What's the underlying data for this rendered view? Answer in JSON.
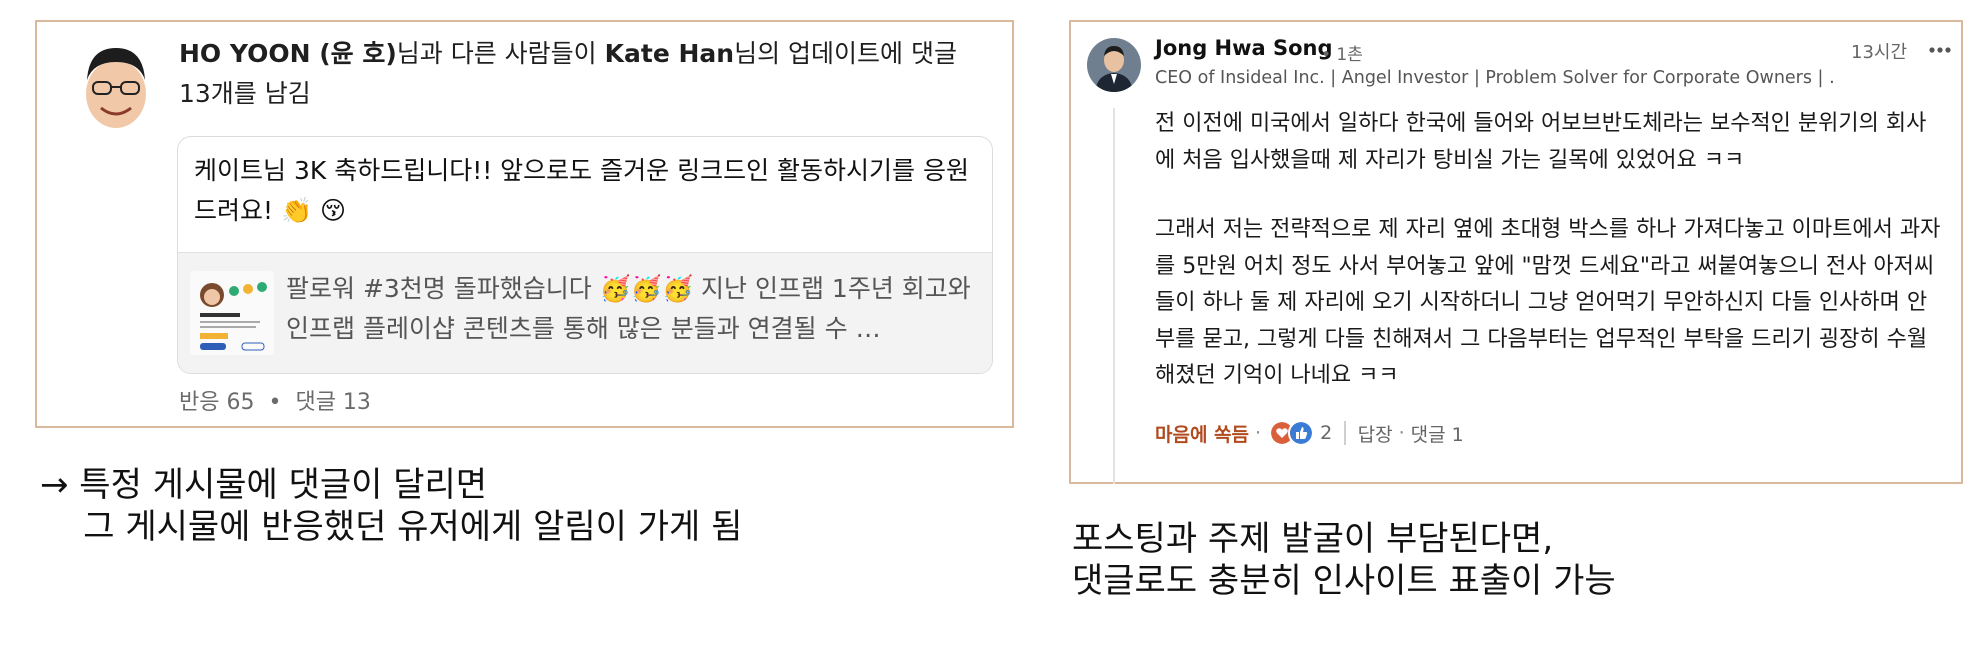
{
  "left_card": {
    "notification": {
      "actor": "HO YOON (윤 호)",
      "text1": "님과 다른 사람들이 ",
      "target": "Kate Han",
      "text2": "님의 업데이트에 댓글 13개를 남김"
    },
    "comment": {
      "text": "케이트님 3K 축하드립니다!! 앞으로도 즐거운 링크드인 활동하시기를 응원드려요! 👏 😚"
    },
    "post_preview": {
      "text": "팔로워 #3천명 돌파했습니다 🥳🥳🥳 지난 인프랩 1주년 회고와 인프랩 플레이샵 콘텐츠를 통해 많은 분들과 연결될 수 …",
      "thumbnail_name": "Kate Han"
    },
    "stats": {
      "reactions": "반응 65",
      "separator": "•",
      "comments": "댓글 13"
    }
  },
  "caption_left": "→ 특정 게시물에 댓글이 달리면\n    그 게시물에 반응했던 유저에게 알림이 가게 됨",
  "right_card": {
    "author": "Jong Hwa Song",
    "degree": "• 1촌",
    "time": "13시간",
    "headline": "CEO of Insideal Inc. | Angel Investor | Problem Solver for Corporate Owners | …",
    "paragraph1": "전 이전에 미국에서 일하다 한국에 들어와 어보브반도체라는 보수적인 분위기의 회사에 처음 입사했을때 제 자리가 탕비실 가는 길목에 있었어요 ㅋㅋ",
    "paragraph2": "그래서 저는 전략적으로 제 자리 옆에 초대형 박스를 하나 가져다놓고 이마트에서 과자를 5만원 어치 정도 사서 부어놓고 앞에 \"맘껏 드세요\"라고 써붙여놓으니 전사 아저씨들이 하나 둘 제 자리에 오기 시작하더니 그냥 얻어먹기 무안하신지 다들 인사하며 안부를 묻고, 그렇게 다들 친해져서 그 다음부터는 업무적인 부탁을 드리기 굉장히 수월해졌던 기억이 나네요 ㅋㅋ",
    "actions": {
      "like_label": "마음에 쏙듬",
      "dot": "·",
      "reaction_count": "2",
      "reply_label": "답장",
      "comment_label": "댓글 1"
    },
    "colors": {
      "like": "#b14a1e",
      "love_reaction": "#d9603b",
      "like_reaction": "#3a7bd5"
    }
  },
  "caption_right": "포스팅과 주제 발굴이 부담된다면,\n댓글로도 충분히 인사이트 표출이 가능"
}
